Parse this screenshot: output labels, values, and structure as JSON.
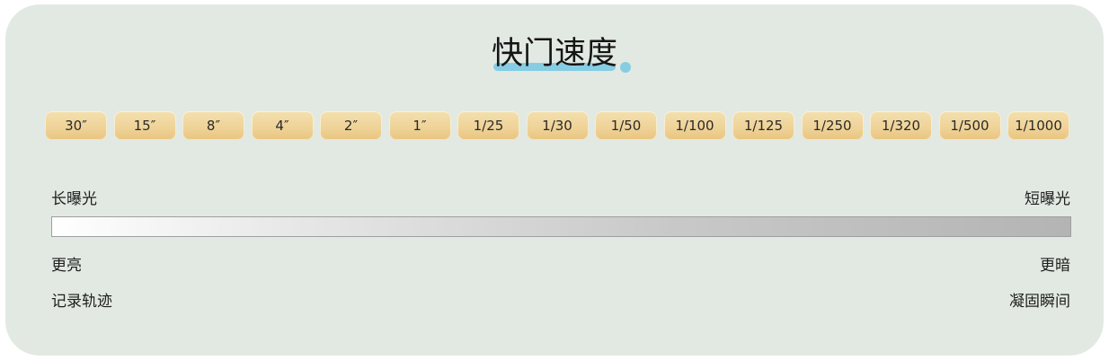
{
  "title": "快门速度",
  "shutter_speeds": [
    "30″",
    "15″",
    "8″",
    "4″",
    "2″",
    "1″",
    "1/25",
    "1/30",
    "1/50",
    "1/100",
    "1/125",
    "1/250",
    "1/320",
    "1/500",
    "1/1000"
  ],
  "scale": {
    "left_label": "长曝光",
    "right_label": "短曝光"
  },
  "effects": {
    "left_brightness": "更亮",
    "right_brightness": "更暗",
    "left_motion": "记录轨迹",
    "right_motion": "凝固瞬间"
  },
  "colors": {
    "background": "#e2e9e2",
    "chip": "#efd297",
    "title_accent": "#86cde4",
    "gradient_start": "#ffffff",
    "gradient_end": "#b4b4b4"
  }
}
